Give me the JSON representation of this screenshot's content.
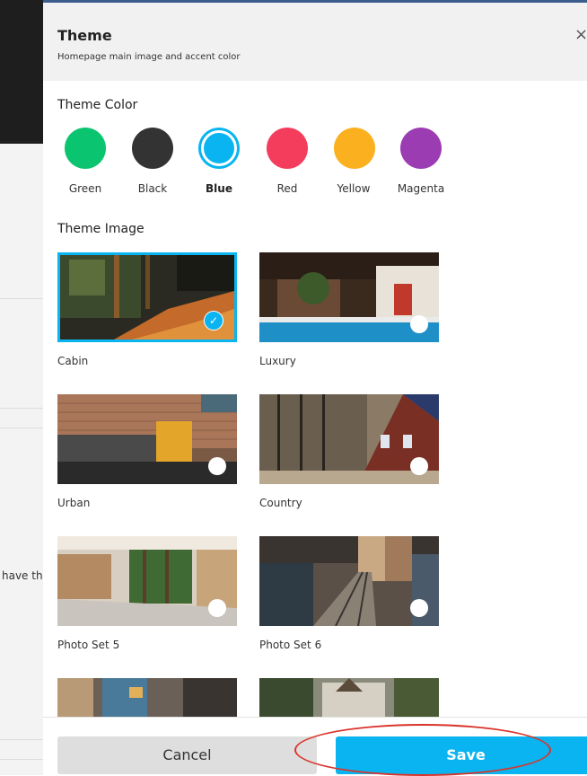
{
  "background": {
    "partial_text": "have th"
  },
  "dialog": {
    "title": "Theme",
    "subtitle": "Homepage main image and accent color",
    "close_icon": "close-icon"
  },
  "theme_color": {
    "heading": "Theme Color",
    "selected": "Blue",
    "colors": [
      {
        "label": "Green",
        "hex": "#0ac46f"
      },
      {
        "label": "Black",
        "hex": "#333333"
      },
      {
        "label": "Blue",
        "hex": "#0ab4f0"
      },
      {
        "label": "Red",
        "hex": "#f43c5c"
      },
      {
        "label": "Yellow",
        "hex": "#fbb11f"
      },
      {
        "label": "Magenta",
        "hex": "#9b3cb3"
      }
    ]
  },
  "theme_image": {
    "heading": "Theme Image",
    "selected": "Cabin",
    "images": [
      {
        "label": "Cabin"
      },
      {
        "label": "Luxury"
      },
      {
        "label": "Urban"
      },
      {
        "label": "Country"
      },
      {
        "label": "Photo Set 5"
      },
      {
        "label": "Photo Set 6"
      }
    ]
  },
  "footer": {
    "cancel_label": "Cancel",
    "save_label": "Save"
  },
  "colors": {
    "accent": "#0ab4f0",
    "annotation_red": "#d9342b"
  }
}
